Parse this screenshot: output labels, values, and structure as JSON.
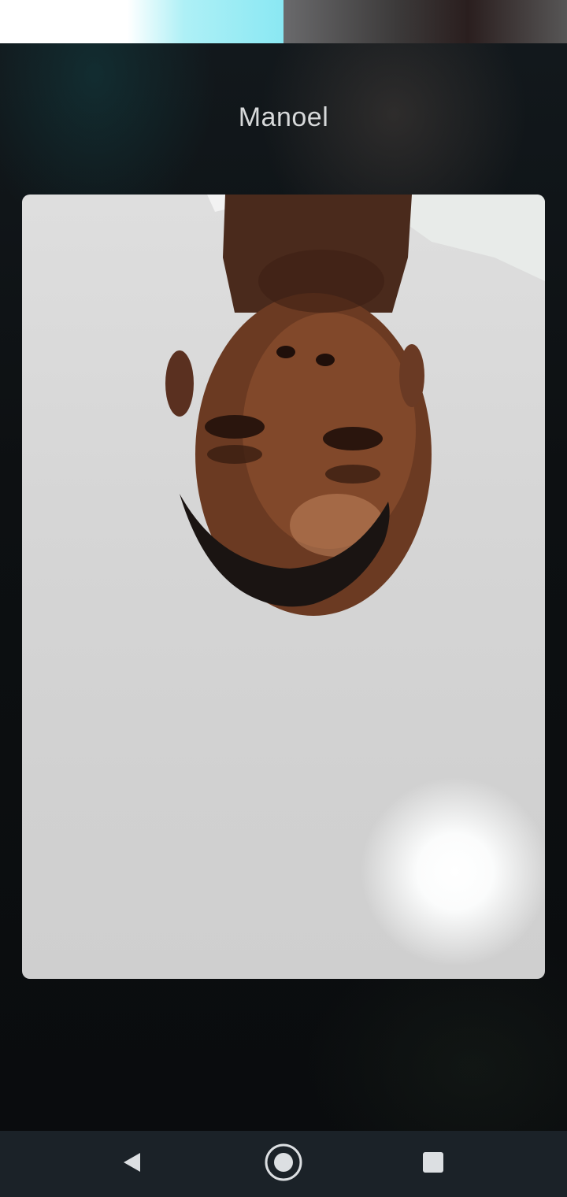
{
  "call": {
    "caller_name": "Manoel"
  },
  "video": {
    "description_icon": "remote-video-feed"
  },
  "navigation": {
    "back_icon": "triangle-back-icon",
    "home_icon": "circle-home-icon",
    "recents_icon": "square-recents-icon"
  },
  "colors": {
    "nav_bar": "#1b2228",
    "caller_name_text": "#d7d9da"
  }
}
